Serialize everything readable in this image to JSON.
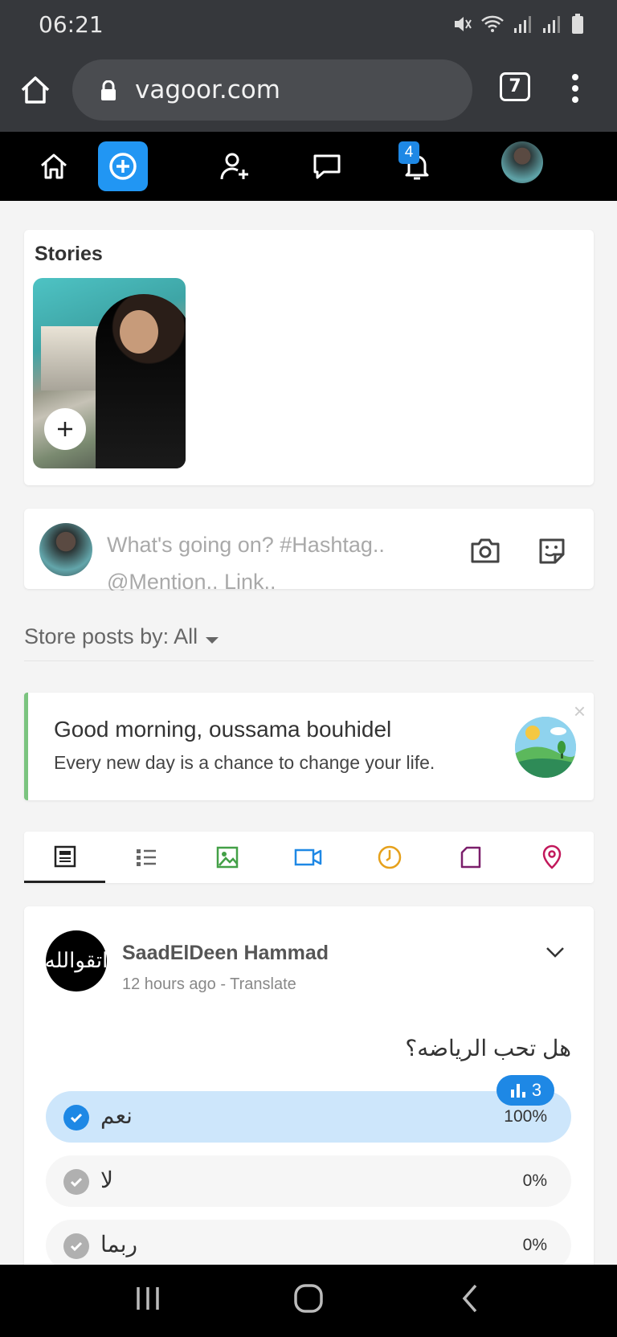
{
  "status_bar": {
    "time": "06:21"
  },
  "browser": {
    "url": "vagoor.com",
    "tab_count": "7"
  },
  "nav": {
    "notification_count": "4"
  },
  "stories": {
    "title": "Stories"
  },
  "composer": {
    "placeholder": "What's going on? #Hashtag.. @Mention.. Link.."
  },
  "filter": {
    "label": "Store posts by: All"
  },
  "greeting": {
    "title": "Good morning, oussama bouhidel",
    "subtitle": "Every new day is a chance to change your life.",
    "close": "×"
  },
  "post": {
    "avatar_text": "اتقوالله",
    "author": "SaadElDeen Hammad",
    "meta": "12 hours ago - Translate",
    "question": "هل تحب الرياضه؟",
    "votes": "3",
    "options": [
      {
        "text": "نعم",
        "percent": "100%"
      },
      {
        "text": "لا",
        "percent": "0%"
      },
      {
        "text": "ربما",
        "percent": "0%"
      }
    ]
  },
  "colors": {
    "accent": "#2196f3",
    "nav_bg": "#000000",
    "greet_border": "#7bc47f"
  }
}
